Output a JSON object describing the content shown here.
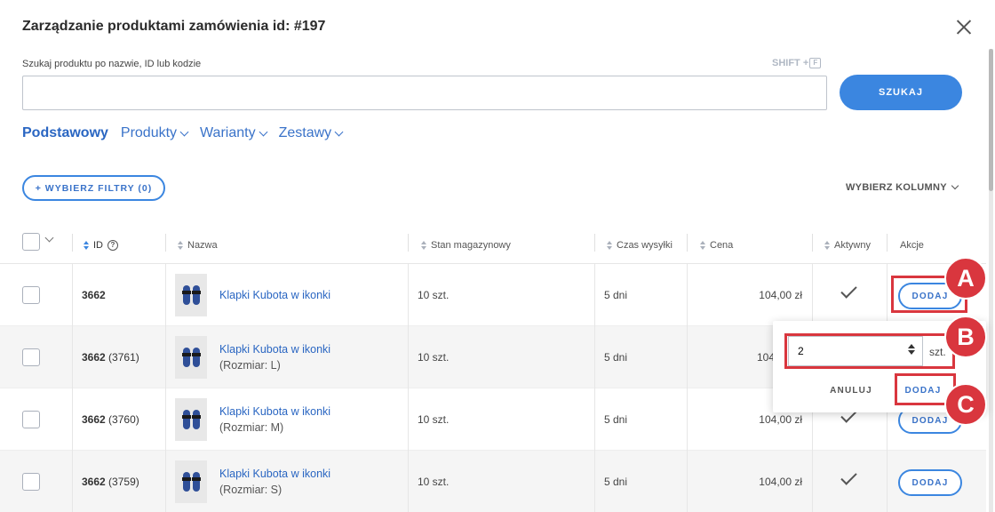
{
  "modal": {
    "title": "Zarządzanie produktami zamówienia id: #197"
  },
  "search": {
    "label": "Szukaj produktu po nazwie, ID lub kodzie",
    "shortcut": "SHIFT +",
    "shortcut_key": "F",
    "value": "",
    "button": "SZUKAJ"
  },
  "tabs": [
    {
      "label": "Podstawowy",
      "active": true
    },
    {
      "label": "Produkty"
    },
    {
      "label": "Warianty"
    },
    {
      "label": "Zestawy"
    }
  ],
  "filters_button": "+ WYBIERZ FILTRY (0)",
  "columns_button": "WYBIERZ KOLUMNY",
  "table": {
    "headers": {
      "id": "ID",
      "name": "Nazwa",
      "stock": "Stan magazynowy",
      "shipping": "Czas wysyłki",
      "price": "Cena",
      "active": "Aktywny",
      "actions": "Akcje"
    },
    "rows": [
      {
        "id": "3662",
        "variant_id": "",
        "name": "Klapki Kubota w ikonki",
        "variant": "",
        "stock": "10 szt.",
        "shipping": "5 dni",
        "price": "104,00 zł",
        "add": "DODAJ"
      },
      {
        "id": "3662",
        "variant_id": "(3761)",
        "name": "Klapki Kubota w ikonki",
        "variant": "(Rozmiar: L)",
        "stock": "10 szt.",
        "shipping": "5 dni",
        "price": "104",
        "add": "DODAJ"
      },
      {
        "id": "3662",
        "variant_id": "(3760)",
        "name": "Klapki Kubota w ikonki",
        "variant": "(Rozmiar: M)",
        "stock": "10 szt.",
        "shipping": "5 dni",
        "price": "104,00 zł",
        "add": "DODAJ"
      },
      {
        "id": "3662",
        "variant_id": "(3759)",
        "name": "Klapki Kubota w ikonki",
        "variant": "(Rozmiar: S)",
        "stock": "10 szt.",
        "shipping": "5 dni",
        "price": "104,00 zł",
        "add": "DODAJ"
      }
    ]
  },
  "popover": {
    "quantity": "2",
    "unit": "szt.",
    "cancel": "ANULUJ",
    "confirm": "DODAJ"
  },
  "annotations": [
    "A",
    "B",
    "C"
  ],
  "colors": {
    "accent": "#3b86e0",
    "link": "#2a66c2",
    "annotation": "#d9363e"
  }
}
